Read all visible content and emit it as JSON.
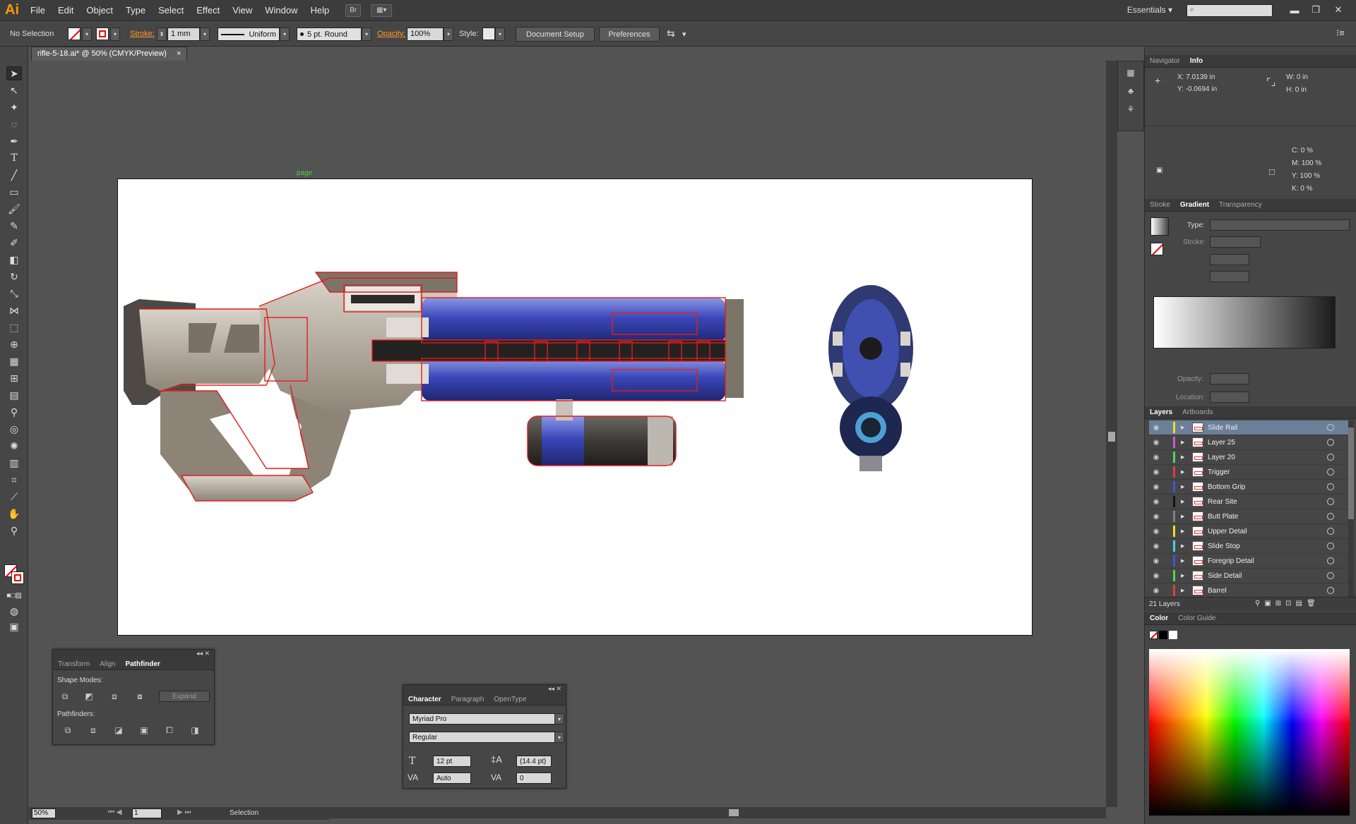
{
  "app": {
    "logo": "Ai"
  },
  "menu": [
    "File",
    "Edit",
    "Object",
    "Type",
    "Select",
    "Effect",
    "View",
    "Window",
    "Help"
  ],
  "menubar": {
    "bridge_icon": "Br",
    "workspace": "Essentials",
    "workspace_arrow": "▾",
    "win_min": "▬",
    "win_restore": "❐",
    "win_close": "✕"
  },
  "control": {
    "selection": "No Selection",
    "stroke_label": "Stroke:",
    "stroke_weight": "1 mm",
    "stroke_profile": "Uniform",
    "brush": "5 pt. Round",
    "opacity_label": "Opacity:",
    "opacity": "100%",
    "style_label": "Style:",
    "doc_setup": "Document Setup",
    "preferences": "Preferences",
    "arrange_icon": "⇆",
    "dropdown": "▾"
  },
  "document": {
    "tab_title": "rifle-5-18.ai* @ 50% (CMYK/Preview)",
    "tab_close": "×",
    "page_label": "page"
  },
  "status": {
    "zoom": "50%",
    "artboard": "1",
    "tool": "Selection"
  },
  "navigator": {
    "tabs": [
      "Navigator",
      "Info"
    ],
    "x": "X:  7.0139 in",
    "y": "Y:  -0.0694 in",
    "w": "W:  0 in",
    "h": "H:  0 in",
    "c": "C:  0 %",
    "m": "M:  100 %",
    "yy": "Y:  100 %",
    "k": "K:  0 %"
  },
  "gradient": {
    "tabs": [
      "Stroke",
      "Gradient",
      "Transparency"
    ],
    "type_label": "Type:",
    "stroke_label": "Stroke:",
    "opacity_label": "Opacity:",
    "location_label": "Location:"
  },
  "layers": {
    "tabs": [
      "Layers",
      "Artboards"
    ],
    "count": "21 Layers",
    "items": [
      {
        "name": "Slide Rail",
        "color": "#e8e020"
      },
      {
        "name": "Layer 25",
        "color": "#d94fd9"
      },
      {
        "name": "Layer 20",
        "color": "#4fd94f"
      },
      {
        "name": "Trigger",
        "color": "#e04040"
      },
      {
        "name": "Bottom Grip",
        "color": "#3a5ad9"
      },
      {
        "name": "Rear Site",
        "color": "#141414"
      },
      {
        "name": "Butt Plate",
        "color": "#808080"
      },
      {
        "name": "Upper Detail",
        "color": "#e8e020"
      },
      {
        "name": "Slide Stop",
        "color": "#40d9d9"
      },
      {
        "name": "Foregrip Detail",
        "color": "#3a5ad9"
      },
      {
        "name": "Side Detail",
        "color": "#4fd94f"
      },
      {
        "name": "Barrel",
        "color": "#e04040"
      }
    ]
  },
  "color_panel": {
    "tabs": [
      "Color",
      "Color Guide"
    ]
  },
  "pathfinder": {
    "tabs": [
      "Transform",
      "Align",
      "Pathfinder"
    ],
    "shape_modes": "Shape Modes:",
    "expand": "Expand",
    "pathfinders": "Pathfinders:"
  },
  "character": {
    "tabs": [
      "Character",
      "Paragraph",
      "OpenType"
    ],
    "font": "Myriad Pro",
    "style": "Regular",
    "size": "12 pt",
    "leading": "(14.4 pt)",
    "kerning": "Auto",
    "tracking": "0"
  }
}
